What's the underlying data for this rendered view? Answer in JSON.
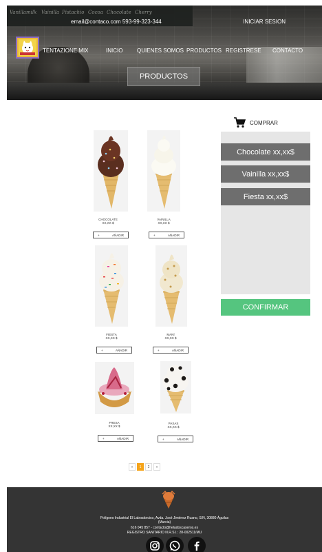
{
  "header": {
    "email_phone": "email@contaco.com    593-99-323-344",
    "login": "INICIAR SESION",
    "brand": "TENTAZIONE MIX",
    "nav": [
      {
        "label": "INICIO"
      },
      {
        "label": "QUIENES SOMOS"
      },
      {
        "label": "PRODUCTOS"
      },
      {
        "label": "REGISTRESE"
      },
      {
        "label": "CONTACTO"
      }
    ],
    "hero_button": "PRODUCTOS",
    "chalkboard": [
      "Vanilla",
      "milk",
      "Vainilla",
      "Pistachio",
      "Cocoa",
      "Chocolate",
      "Cherry"
    ]
  },
  "products": [
    {
      "name": "CHOCOLATE",
      "price": "XX,XX $",
      "add_label": "AÑADIR",
      "plus": "+",
      "flavor_color": "#5a2e1f",
      "icon": "chocolate-cone-icon"
    },
    {
      "name": "VAINILLA",
      "price": "XX,XX $",
      "add_label": "AÑADIR",
      "plus": "+",
      "flavor_color": "#f8f6ec",
      "icon": "vanilla-cone-icon"
    },
    {
      "name": "FIESTA",
      "price": "XX,XX $",
      "add_label": "AÑADIR",
      "plus": "+",
      "flavor_color": "#f5efe4",
      "icon": "fiesta-cone-icon"
    },
    {
      "name": "MANÍ",
      "price": "XX,XX $",
      "add_label": "AÑADIR",
      "plus": "+",
      "flavor_color": "#e6d7b0",
      "icon": "peanut-cone-icon"
    },
    {
      "name": "FRESA",
      "price": "XX,XX $",
      "add_label": "AÑADIR",
      "plus": "+",
      "flavor_color": "#d86a8a",
      "icon": "strawberry-cup-icon"
    },
    {
      "name": "PASAS",
      "price": "XX,XX $",
      "add_label": "AÑADIR",
      "plus": "+",
      "flavor_color": "#f4f2ee",
      "icon": "raisin-cone-icon"
    }
  ],
  "cart": {
    "title": "COMPRAR",
    "items": [
      {
        "label": "Chocolate xx,xx$"
      },
      {
        "label": "Vainilla xx,xx$"
      },
      {
        "label": "Fiesta xx,xx$"
      }
    ],
    "confirm": "CONFIRMAR"
  },
  "pagination": {
    "prev": "«",
    "pages": [
      "1",
      "2"
    ],
    "next": "»",
    "active": "1"
  },
  "footer": {
    "address": "Polígono Industrial El Labradorcico, Avda. José Jiménez Ruano, S/N, 30880 Águilas",
    "region": "(Murcia)",
    "contact": "616 045 857 -  contacto@heladoscaseros.es",
    "registry": "REGISTRO SANITARIO N.R.S.I.: 28-002511/MU"
  },
  "colors": {
    "accent_orange": "#f5a41a",
    "confirm_green": "#55c57f",
    "cart_item": "#6e6e6e",
    "footer_bg": "#343434"
  }
}
